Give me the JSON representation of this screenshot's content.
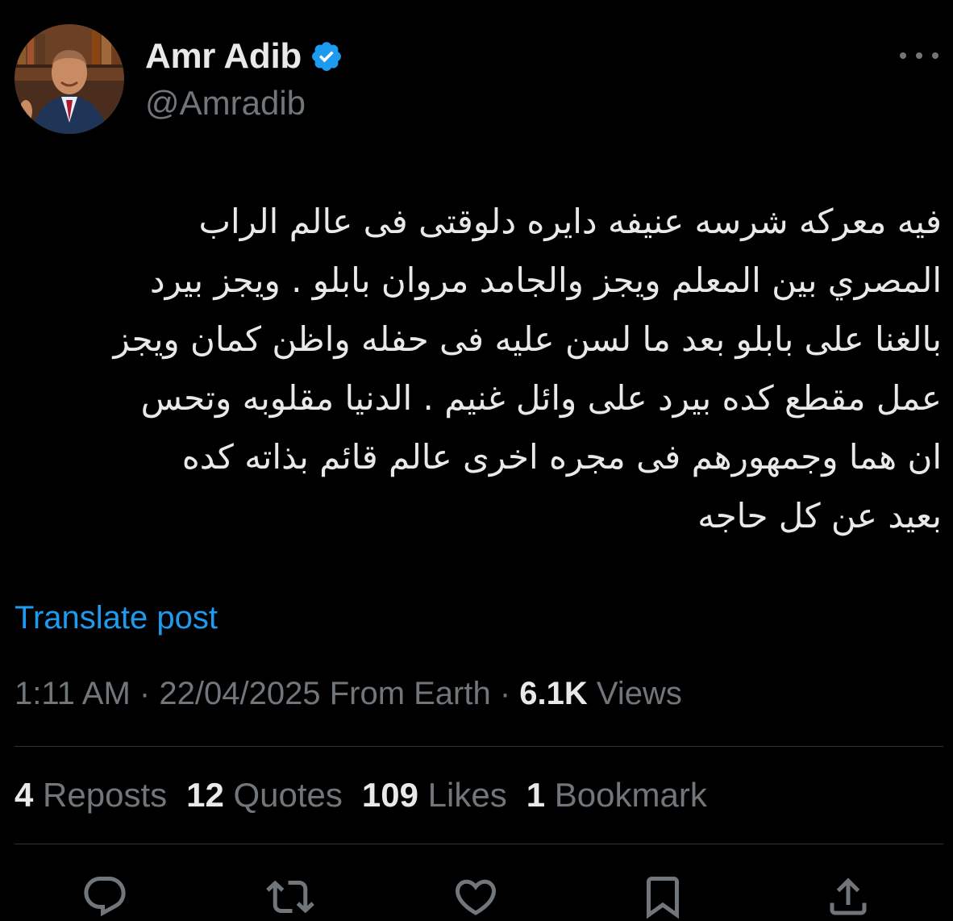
{
  "author": {
    "display_name": "Amr Adib",
    "handle": "@Amradib",
    "verified_icon": "verified-badge-icon"
  },
  "tweet": {
    "lines": [
      "فيه معركه شرسه عنيفه دايره دلوقتى فى عالم الراب",
      "المصري بين المعلم ويجز والجامد مروان بابلو . ويجز بيرد",
      "بالغنا على بابلو بعد ما لسن عليه فى حفله واظن كمان ويجز",
      "عمل مقطع كده بيرد على وائل غنيم . الدنيا مقلوبه وتحس",
      "ان هما وجمهورهم فى مجره اخرى عالم قائم بذاته كده",
      "بعيد عن كل حاجه"
    ],
    "translate_label": "Translate post"
  },
  "meta": {
    "time": "1:11 AM",
    "date": "22/04/2025",
    "location": "From Earth",
    "views_count": "6.1K",
    "views_label": "Views"
  },
  "stats": {
    "reposts_count": "4",
    "reposts_label": "Reposts",
    "quotes_count": "12",
    "quotes_label": "Quotes",
    "likes_count": "109",
    "likes_label": "Likes",
    "bookmarks_count": "1",
    "bookmarks_label": "Bookmark"
  },
  "actions": [
    "reply-icon",
    "repost-icon",
    "like-icon",
    "bookmark-icon",
    "share-icon"
  ],
  "colors": {
    "background": "#000000",
    "text_primary": "#e7e9ea",
    "text_secondary": "#71767b",
    "accent": "#1d9bf0",
    "divider": "#2f3336"
  }
}
